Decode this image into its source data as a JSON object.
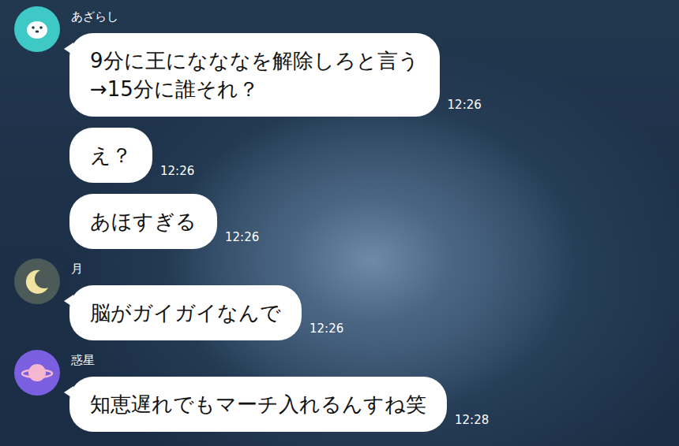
{
  "chat": {
    "groups": [
      {
        "sender": "あざらし",
        "color": "#3ec9c6",
        "messages": [
          {
            "text": "9分に王になななを解除しろと言う\n→15分に誰それ？",
            "time": "12:26"
          },
          {
            "text": "え？",
            "time": "12:26"
          },
          {
            "text": "あほすぎる",
            "time": "12:26"
          }
        ]
      },
      {
        "sender": "月",
        "color": "#4d5b58",
        "messages": [
          {
            "text": "脳がガイガイなんで",
            "time": "12:26"
          }
        ]
      },
      {
        "sender": "惑星",
        "color": "#7a5fe0",
        "messages": [
          {
            "text": "知恵遅れでもマーチ入れるんすね笑",
            "time": "12:28"
          }
        ]
      }
    ]
  }
}
